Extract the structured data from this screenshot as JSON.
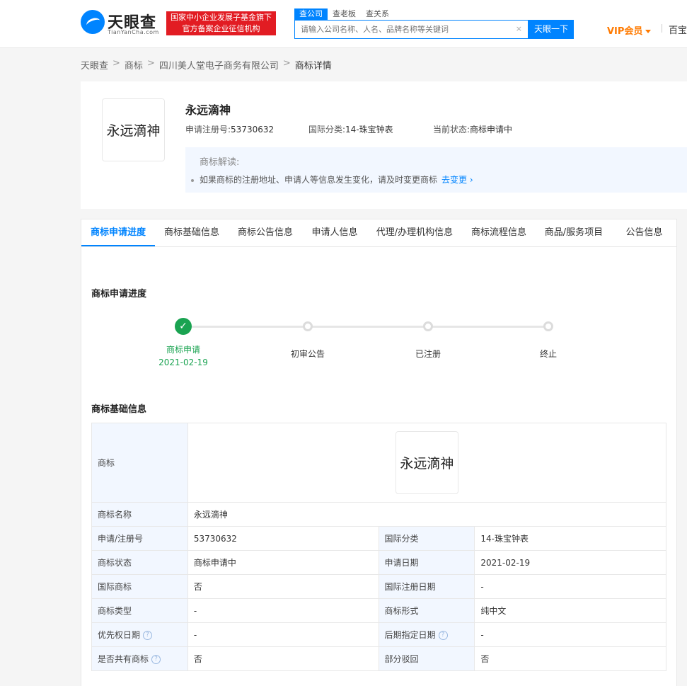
{
  "header": {
    "logo_text": "天眼查",
    "logo_sub": "TianYanCha.com",
    "badge_line1": "国家中小企业发展子基金旗下",
    "badge_line2": "官方备案企业征信机构",
    "search_tabs": [
      "查公司",
      "查老板",
      "查关系"
    ],
    "search_placeholder": "请输入公司名称、人名、品牌名称等关键词",
    "search_clear": "×",
    "search_button": "天眼一下",
    "vip_label": "VIP会员",
    "more_label": "百宝"
  },
  "breadcrumb": {
    "items": [
      "天眼查",
      "商标",
      "四川美人堂电子商务有限公司",
      "商标详情"
    ],
    "separator": ">"
  },
  "trademark": {
    "image_text": "永远滴神",
    "name": "永远滴神",
    "reg_no_label": "申请注册号:",
    "reg_no": "53730632",
    "intl_class_label": "国际分类:",
    "intl_class": "14-珠宝钟表",
    "status_label": "当前状态:",
    "status": "商标申请中",
    "tip_title": "商标解读:",
    "tip_text": "如果商标的注册地址、申请人等信息发生变化，请及时变更商标",
    "tip_link": "去变更"
  },
  "tabs": [
    "商标申请进度",
    "商标基础信息",
    "商标公告信息",
    "申请人信息",
    "代理/办理机构信息",
    "商标流程信息",
    "商品/服务项目",
    "公告信息"
  ],
  "progress": {
    "title": "商标申请进度",
    "steps": [
      {
        "label": "商标申请",
        "date": "2021-02-19",
        "done": true
      },
      {
        "label": "初审公告",
        "date": "",
        "done": false
      },
      {
        "label": "已注册",
        "date": "",
        "done": false
      },
      {
        "label": "终止",
        "date": "",
        "done": false
      }
    ]
  },
  "basic_info": {
    "title": "商标基础信息",
    "trademark_label": "商标",
    "trademark_image_text": "永远滴神",
    "name_label": "商标名称",
    "name_value": "永远滴神",
    "rows": [
      {
        "k1": "申请/注册号",
        "v1": "53730632",
        "k2": "国际分类",
        "v2": "14-珠宝钟表",
        "q1": false,
        "q2": false
      },
      {
        "k1": "商标状态",
        "v1": "商标申请中",
        "k2": "申请日期",
        "v2": "2021-02-19",
        "q1": false,
        "q2": false
      },
      {
        "k1": "国际商标",
        "v1": "否",
        "k2": "国际注册日期",
        "v2": "-",
        "q1": false,
        "q2": false
      },
      {
        "k1": "商标类型",
        "v1": "-",
        "k2": "商标形式",
        "v2": "纯中文",
        "q1": false,
        "q2": false
      },
      {
        "k1": "优先权日期",
        "v1": "-",
        "k2": "后期指定日期",
        "v2": "-",
        "q1": true,
        "q2": true
      },
      {
        "k1": "是否共有商标",
        "v1": "否",
        "k2": "部分驳回",
        "v2": "否",
        "q1": true,
        "q2": false
      }
    ],
    "help_icon": "?"
  }
}
